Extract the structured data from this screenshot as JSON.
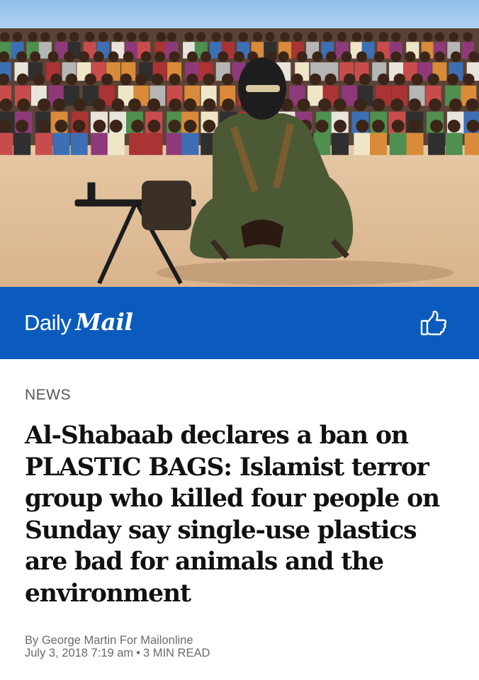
{
  "hero": {
    "photo_name": "photo-gunman-seated-before-crowd",
    "sign_text": ""
  },
  "brand": {
    "daily": "Daily",
    "mail": "Mail",
    "bar_color": "#0a5bbd",
    "like_icon": "thumbs-up-icon"
  },
  "article": {
    "section": "NEWS",
    "headline": "Al-Shabaab declares a ban on PLASTIC BAGS: Islamist terror group who killed four people on Sunday say single-use plastics are bad for animals and the environment",
    "byline": "By George Martin For Mailonline",
    "date": "July 3, 2018 7:19 am",
    "separator": "•",
    "read_time": "3 MIN READ"
  }
}
